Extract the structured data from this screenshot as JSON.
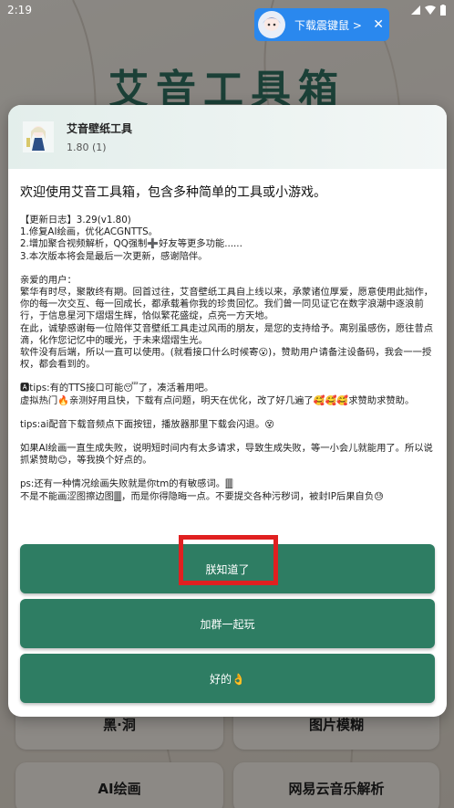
{
  "status_bar": {
    "time": "2:19"
  },
  "background": {
    "title": "艾音工具箱",
    "buttons": [
      {
        "label": "黑·洞"
      },
      {
        "label": "图片模糊"
      },
      {
        "label": "AI绘画"
      },
      {
        "label": "网易云音乐解析"
      }
    ]
  },
  "toast": {
    "text": "下载震键鼠 >",
    "close": "✕"
  },
  "dialog": {
    "app_name": "艾音壁纸工具",
    "app_version": "1.80 (1)",
    "welcome": "欢迎使用艾音工具箱，包含多种简单的工具或小游戏。",
    "changelog": [
      "【更新日志】3.29(v1.80)",
      "1.修复AI绘画，优化ACGNTTS。",
      "2.增加聚合视频解析，QQ强制➕好友等更多功能......",
      "3.本次版本将会是最后一次更新，感谢陪伴。"
    ],
    "letter": [
      "亲爱的用户：",
      "繁华有时尽，聚散终有期。回首过往，艾音壁纸工具自上线以来，承蒙诸位厚爱，愿意使用此拙作，你的每一次交互、每一回成长，都承载着你我的珍贵回忆。我们曾一同见证它在数字浪潮中逐浪前行，于信息星河下熠熠生辉，恰似繁花盛绽，点亮一方天地。",
      "在此，诚挚感谢每一位陪伴艾音壁纸工具走过风雨的朋友，是您的支持给予。离别虽感伤，愿往昔点滴，化作您记忆中的暖光，于未来熠熠生光。",
      "软件没有后端，所以一直可以使用。(就看接口什么时候寄😮)，赞助用户请备注设备码，我会一一授权，都会看到的。"
    ],
    "tips1": [
      "🅰tips:有的TTS接口可能😴了，凑活着用吧。",
      "虚拟热门🔥亲测好用且快，下载有点问题，明天在优化，改了好几遍了🥰🥰🥰求赞助求赞助。"
    ],
    "tips2": "tips:ai配音下载音频点下面按钮，播放器那里下载会闪退。😵",
    "ai_note": [
      "如果AI绘画一直生成失败，说明短时间内有太多请求，导致生成失败，等一小会儿就能用了。所以说抓紧赞助😊，等我换个好点的。"
    ],
    "ps": [
      "ps:还有一种情况绘画失败就是你tm的有敏感词。🀫",
      "不是不能画涩图擦边图🀫，而是你得隐晦一点。不要提交各种污秽词，被封IP后果自负😓"
    ],
    "buttons": {
      "confirm": "朕知道了",
      "join_group": "加群一起玩",
      "ok": "好的👌"
    }
  },
  "colors": {
    "button_green": "#2e7d63",
    "highlight_red": "#e02020",
    "toast_blue": "#2a88ee"
  }
}
